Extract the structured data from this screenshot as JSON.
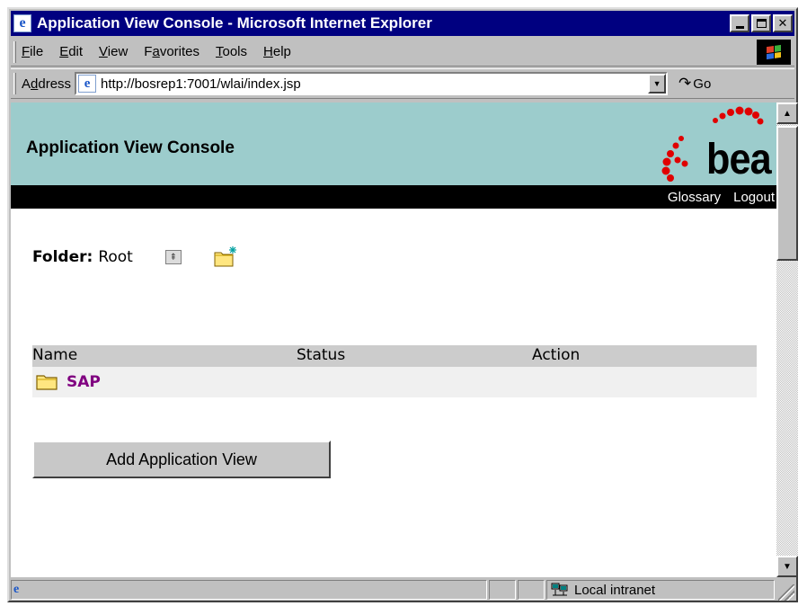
{
  "window": {
    "title": "Application View Console - Microsoft Internet Explorer"
  },
  "menu": {
    "file": {
      "u": "F",
      "rest": "ile"
    },
    "edit": {
      "u": "E",
      "rest": "dit"
    },
    "view": {
      "u": "V",
      "rest": "iew"
    },
    "favorites": {
      "pre": "F",
      "u": "a",
      "rest": "vorites"
    },
    "tools": {
      "u": "T",
      "rest": "ools"
    },
    "help": {
      "u": "H",
      "rest": "elp"
    }
  },
  "address": {
    "label_pre": "A",
    "label_u": "d",
    "label_rest": "dress",
    "url": "http://bosrep1:7001/wlai/index.jsp",
    "go_label": "Go"
  },
  "banner": {
    "title": "Application View Console",
    "logo_text": "bea",
    "links": {
      "glossary": "Glossary",
      "logout": "Logout"
    }
  },
  "folder": {
    "label": "Folder:",
    "name": "Root"
  },
  "table": {
    "headers": {
      "name": "Name",
      "status": "Status",
      "action": "Action"
    },
    "rows": [
      {
        "name": "SAP",
        "status": "",
        "action": ""
      }
    ]
  },
  "add_button": {
    "label": "Add Application View"
  },
  "status_bar": {
    "zone": "Local intranet"
  },
  "colors": {
    "title_bar": "#000080",
    "banner": "#9ccccc",
    "link_visited": "#800080"
  }
}
